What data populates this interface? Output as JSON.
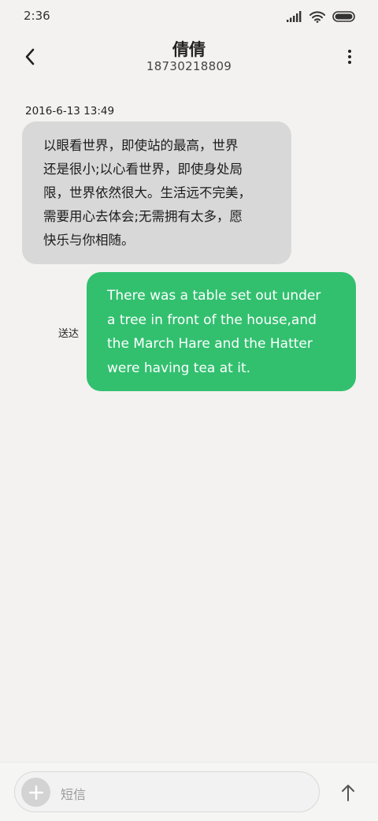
{
  "status_bar": {
    "time": "2:36",
    "icons": [
      "signal-icon",
      "wifi-icon",
      "battery-icon"
    ]
  },
  "header": {
    "contact_name": "倩倩",
    "contact_number": "18730218809",
    "back_icon": "chevron-left-icon",
    "menu_icon": "more-vertical-icon"
  },
  "conversation": {
    "timestamp": "2016-6-13 13:49",
    "messages": [
      {
        "direction": "incoming",
        "lines": [
          "以眼看世界，即使站的最高，世界",
          "还是很小;以心看世界，即使身处局",
          "限，世界依然很大。生活远不完美，",
          "需要用心去体会;无需拥有太多，愿",
          "快乐与你相随。"
        ]
      },
      {
        "direction": "outgoing",
        "status": "送达",
        "lines": [
          "There was a table set out under",
          "a tree in front of the house,and",
          "the March Hare and the Hatter",
          "were having tea at it."
        ]
      }
    ]
  },
  "composer": {
    "placeholder": "短信",
    "add_icon": "plus-icon",
    "send_icon": "arrow-up-icon"
  },
  "colors": {
    "background": "#f3f2f0",
    "incoming_bubble": "#d8d8d8",
    "outgoing_bubble": "#32c06f"
  }
}
